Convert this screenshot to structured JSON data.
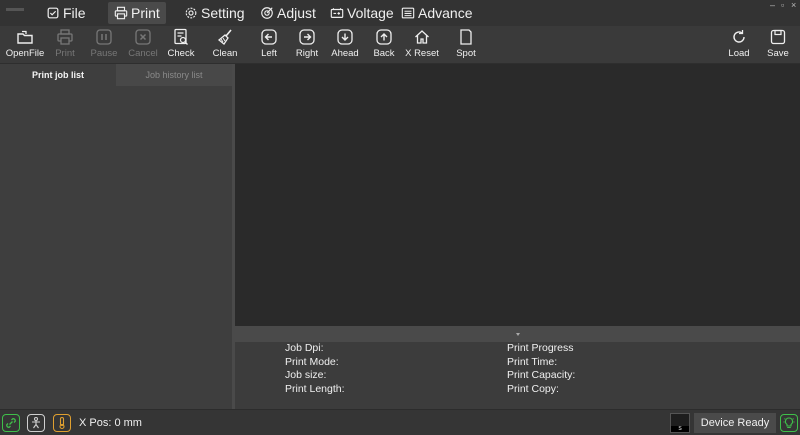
{
  "menu": {
    "items": [
      {
        "label": "File",
        "icon": "file-check-icon"
      },
      {
        "label": "Print",
        "icon": "printer-icon",
        "active": true
      },
      {
        "label": "Setting",
        "icon": "gear-icon"
      },
      {
        "label": "Adjust",
        "icon": "target-icon"
      },
      {
        "label": "Voltage",
        "icon": "battery-icon"
      },
      {
        "label": "Advance",
        "icon": "list-box-icon"
      }
    ]
  },
  "toolbar": {
    "tools": [
      {
        "label": "OpenFile",
        "icon": "open-file-icon",
        "enabled": true
      },
      {
        "label": "Print",
        "icon": "printer-icon",
        "enabled": false
      },
      {
        "label": "Pause",
        "icon": "pause-icon",
        "enabled": false
      },
      {
        "label": "Cancel",
        "icon": "cancel-icon",
        "enabled": false
      },
      {
        "label": "Check",
        "icon": "check-doc-icon",
        "enabled": true
      },
      {
        "label": "Clean",
        "icon": "brush-icon",
        "enabled": true
      },
      {
        "label": "Left",
        "icon": "arrow-left-icon",
        "enabled": true
      },
      {
        "label": "Right",
        "icon": "arrow-right-icon",
        "enabled": true
      },
      {
        "label": "Ahead",
        "icon": "arrow-down-icon",
        "enabled": true
      },
      {
        "label": "Back",
        "icon": "arrow-up-icon",
        "enabled": true
      },
      {
        "label": "X Reset",
        "icon": "home-icon",
        "enabled": true
      },
      {
        "label": "Spot",
        "icon": "spot-icon",
        "enabled": true
      },
      {
        "label": "Load",
        "icon": "reload-icon",
        "enabled": true
      },
      {
        "label": "Save",
        "icon": "save-icon",
        "enabled": true
      }
    ]
  },
  "tabs": {
    "print_job_list": "Print job list",
    "job_history_list": "Job history list"
  },
  "job_info": {
    "left": [
      "Job Dpi:",
      "Print Mode:",
      "Job size:",
      "Print Length:"
    ],
    "right": [
      "Print Progress",
      "Print Time:",
      "Print Capacity:",
      "Print Copy:"
    ]
  },
  "status": {
    "x_pos": "X Pos: 0 mm",
    "mini_screen_label": "S",
    "device_state": "Device Ready",
    "colors": {
      "ok_green": "#3fbf4a",
      "warn_orange": "#e0a030",
      "neutral": "#cfcfcf"
    }
  }
}
